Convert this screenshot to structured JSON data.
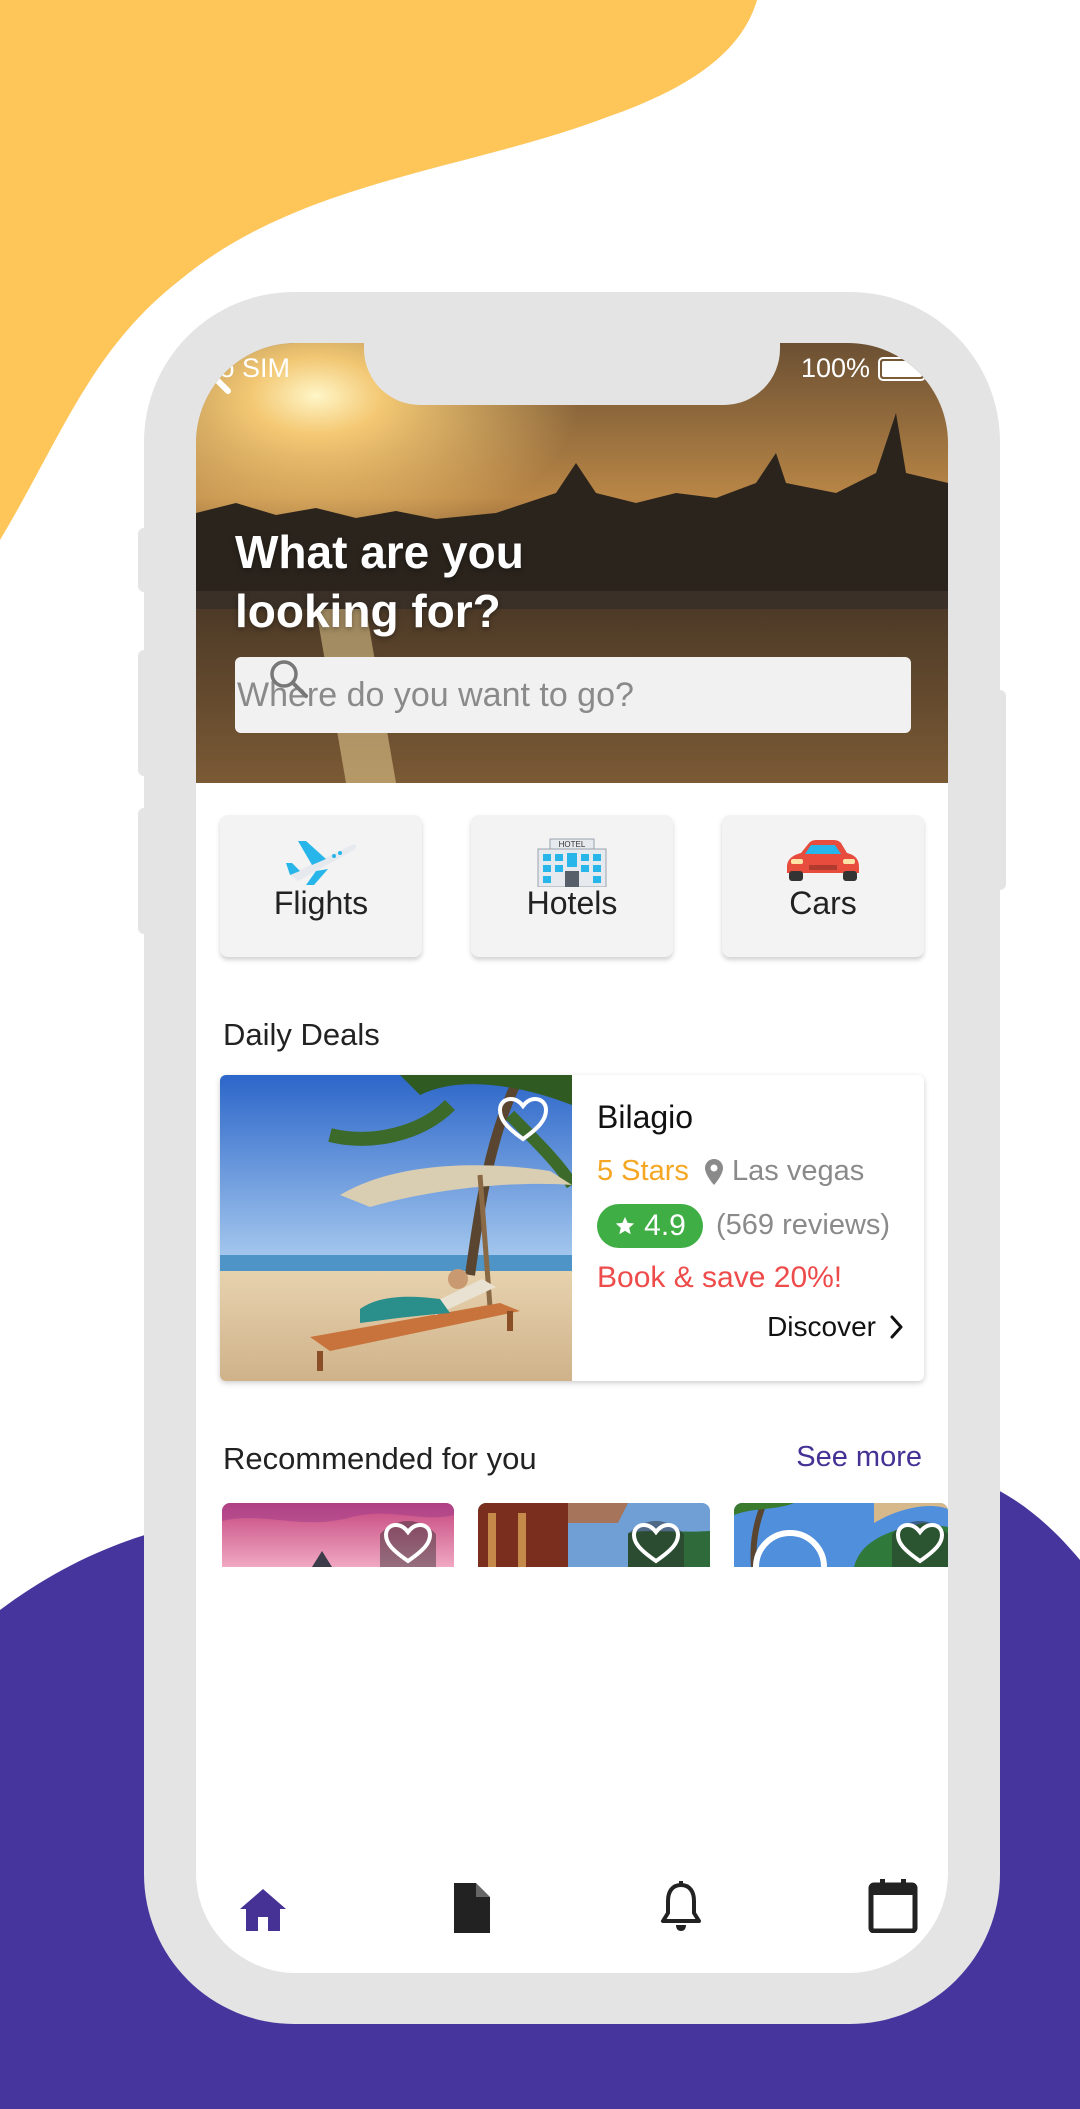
{
  "colors": {
    "accent": "#453294",
    "yellow_blob": "#fec659",
    "purple_blob": "#46359d",
    "stars": "#f5a623",
    "rating_green": "#3fae45",
    "promo_red": "#ee4b4b"
  },
  "status_bar": {
    "carrier": "No SIM",
    "battery": "100%"
  },
  "hero": {
    "title": "What are you looking for?",
    "search_placeholder": "Where do you want to go?"
  },
  "categories": [
    {
      "label": "Flights",
      "icon": "airplane-icon"
    },
    {
      "label": "Hotels",
      "icon": "hotel-icon"
    },
    {
      "label": "Cars",
      "icon": "car-icon"
    }
  ],
  "hotel_sign": "HOTEL",
  "daily_deals": {
    "title": "Daily Deals",
    "deal": {
      "name": "Bilagio",
      "stars": "5 Stars",
      "location": "Las vegas",
      "rating": "4.9",
      "reviews": "(569 reviews)",
      "promo": "Book & save 20%!",
      "cta": "Discover"
    }
  },
  "recommended": {
    "title": "Recommended for you",
    "see_more": "See more"
  },
  "tabbar": [
    {
      "icon": "home-icon",
      "active": true
    },
    {
      "icon": "document-icon",
      "active": false
    },
    {
      "icon": "bell-icon",
      "active": false
    },
    {
      "icon": "calendar-icon",
      "active": false
    }
  ]
}
